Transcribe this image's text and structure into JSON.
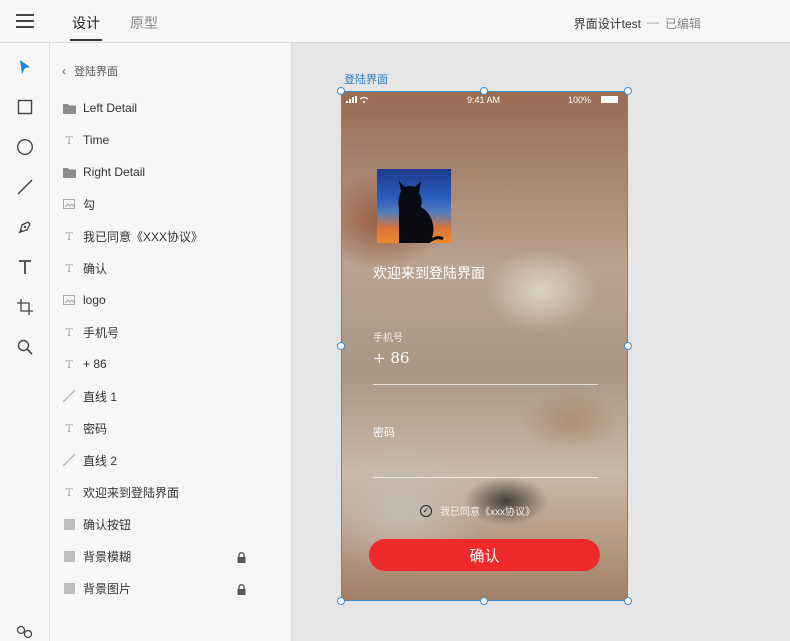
{
  "header": {
    "menu_icon": "hamburger-icon",
    "tabs": [
      {
        "label": "设计",
        "active": true
      },
      {
        "label": "原型",
        "active": false
      }
    ],
    "document_title": "界面设计test",
    "separator": "—",
    "status": "已编辑"
  },
  "tools": [
    {
      "name": "select-arrow-icon"
    },
    {
      "name": "rectangle-icon"
    },
    {
      "name": "ellipse-icon"
    },
    {
      "name": "line-icon"
    },
    {
      "name": "pen-icon"
    },
    {
      "name": "text-icon"
    },
    {
      "name": "artboard-icon"
    },
    {
      "name": "zoom-icon"
    },
    {
      "name": "components-icon"
    }
  ],
  "layers": {
    "back_label": "登陆界面",
    "items": [
      {
        "label": "Left Detail",
        "type": "folder"
      },
      {
        "label": "Time",
        "type": "text"
      },
      {
        "label": "Right Detail",
        "type": "folder"
      },
      {
        "label": "勾",
        "type": "image"
      },
      {
        "label": "我已同意《XXX协议》",
        "type": "text"
      },
      {
        "label": "确认",
        "type": "text"
      },
      {
        "label": "logo",
        "type": "image"
      },
      {
        "label": "手机号",
        "type": "text"
      },
      {
        "label": "+ 86",
        "type": "text"
      },
      {
        "label": "直线 1",
        "type": "line"
      },
      {
        "label": "密码",
        "type": "text"
      },
      {
        "label": "直线 2",
        "type": "line"
      },
      {
        "label": "欢迎来到登陆界面",
        "type": "text"
      },
      {
        "label": "确认按钮",
        "type": "rect"
      },
      {
        "label": "背景模糊",
        "type": "rect",
        "locked": true
      },
      {
        "label": "背景图片",
        "type": "rect",
        "locked": true
      }
    ]
  },
  "artboard": {
    "name": "登陆界面",
    "status_time": "9:41 AM",
    "status_battery": "100%",
    "welcome": "欢迎来到登陆界面",
    "phone_label": "手机号",
    "phone_prefix": "+ 86",
    "password_label": "密码",
    "agreement": "我已同意《xxx协议》",
    "confirm": "确认"
  },
  "colors": {
    "accent_blue": "#3a8fd9",
    "button_red": "#ee2a2a"
  }
}
